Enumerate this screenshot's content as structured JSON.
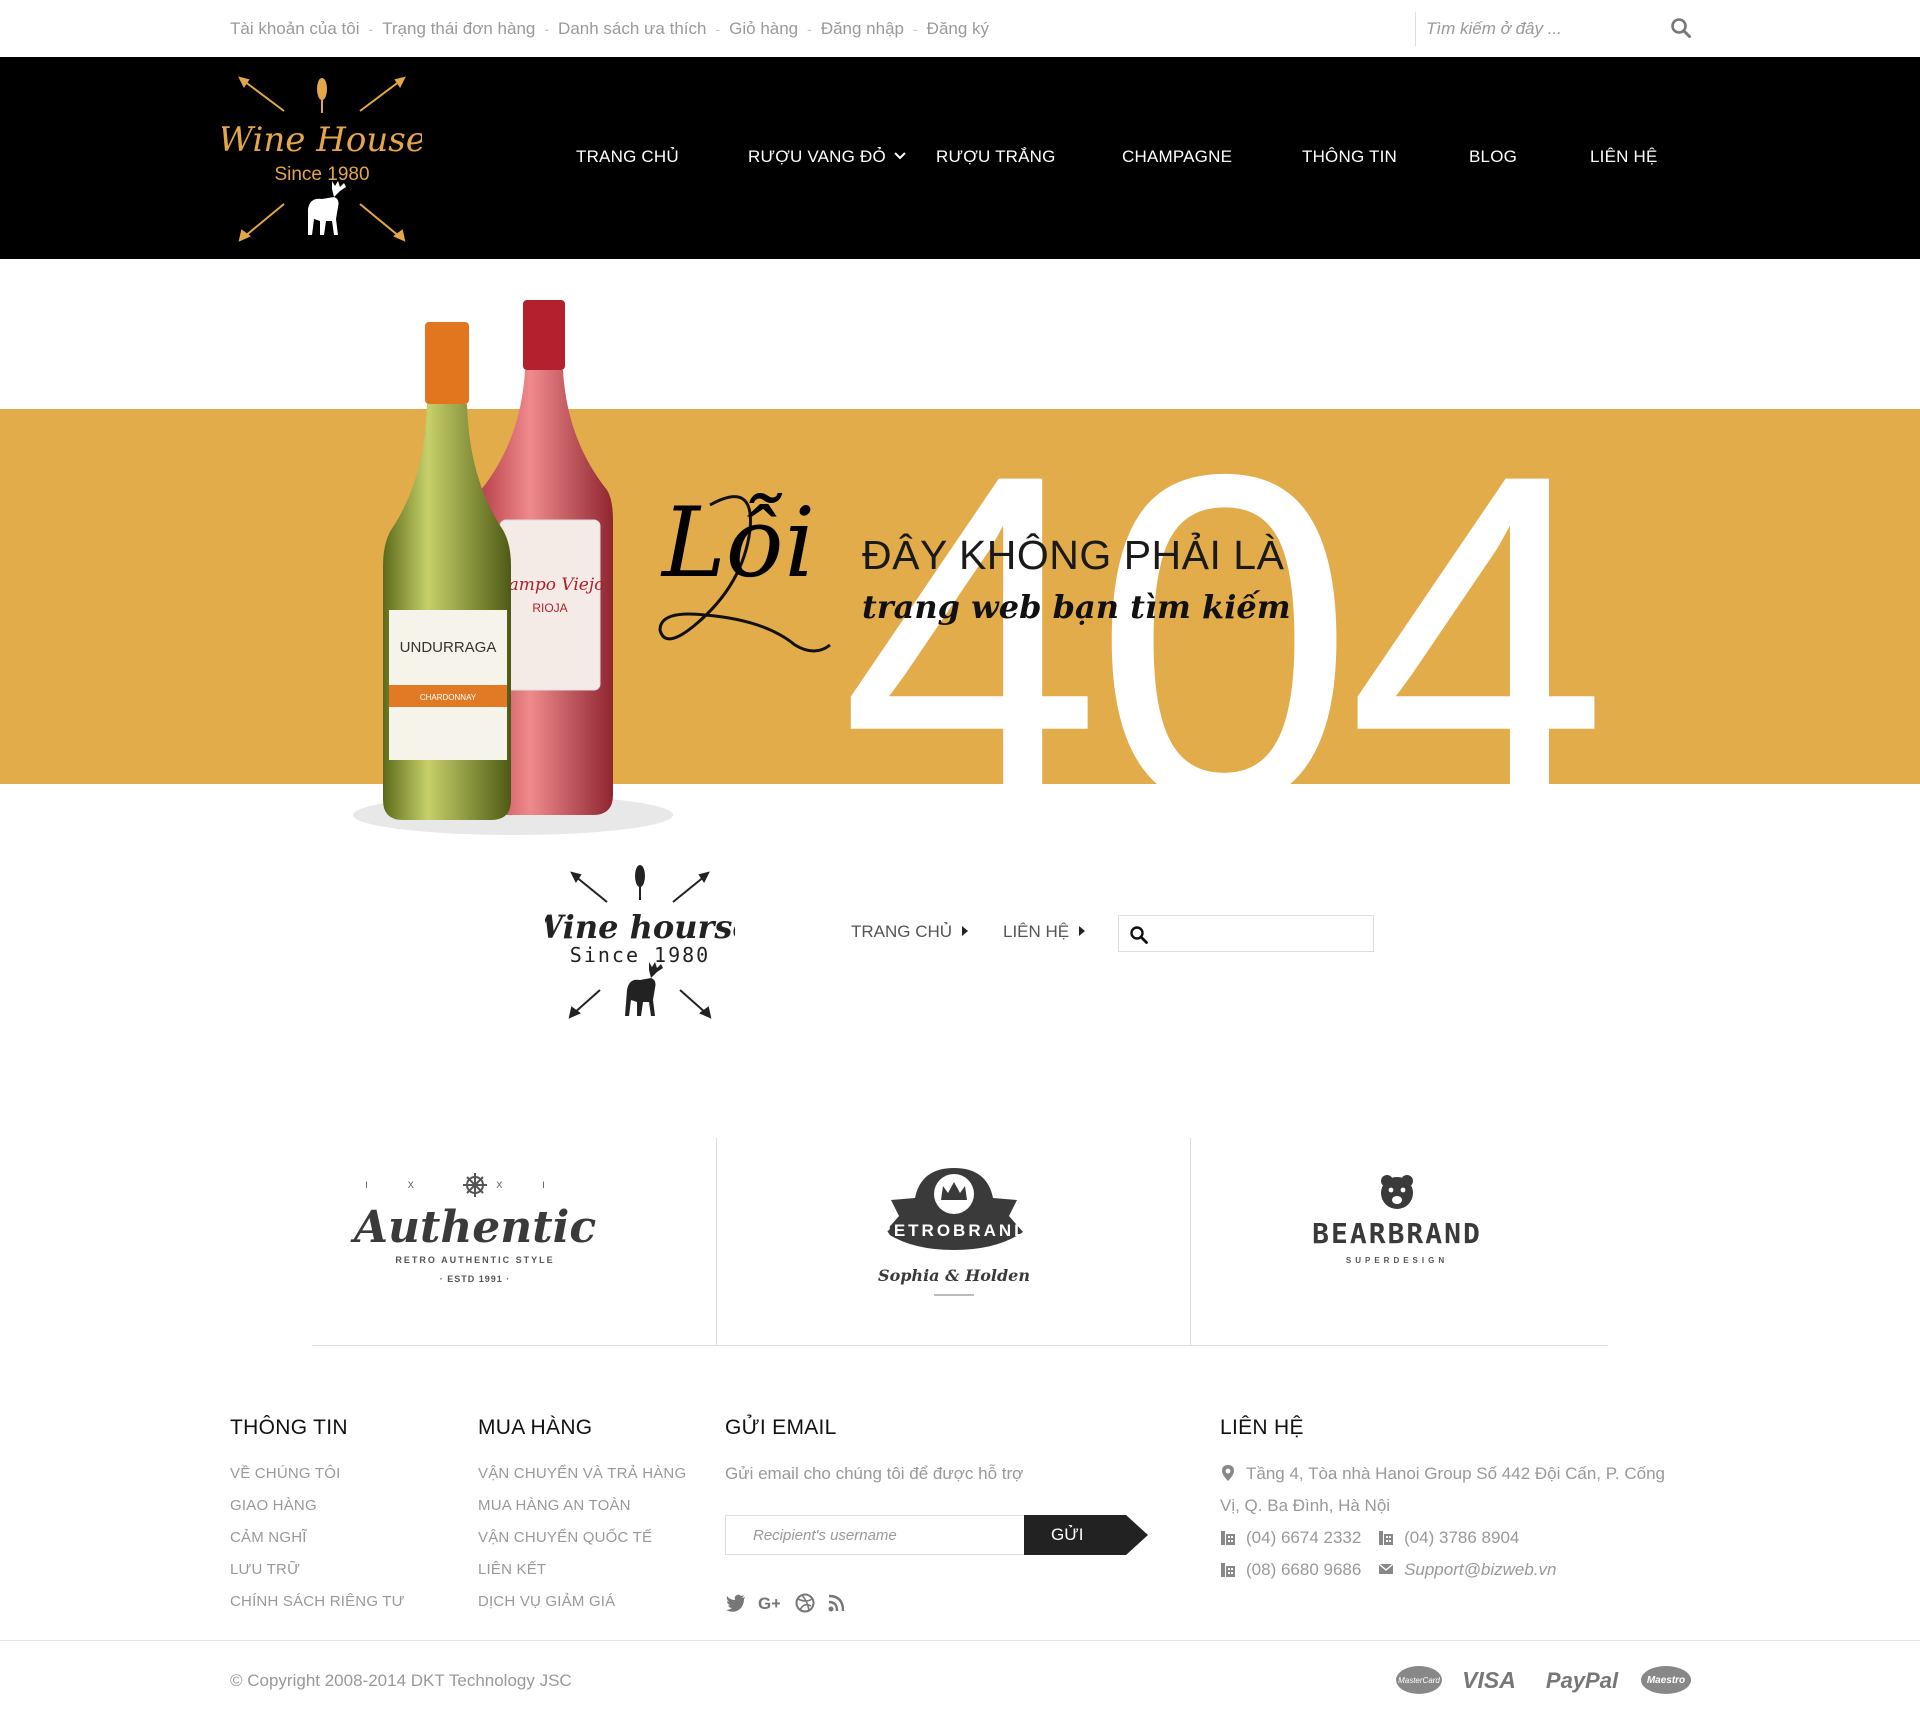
{
  "topbar": {
    "links": [
      "Tài khoản của tôi",
      "Trạng thái đơn hàng",
      "Danh sách ưa thích",
      "Giỏ hàng",
      "Đăng nhập",
      "Đăng ký"
    ],
    "separator": "-",
    "search_placeholder": "Tìm kiếm ở đây ..."
  },
  "header": {
    "logo": {
      "name": "Wine House",
      "tagline": "Since 1980"
    },
    "nav": [
      "TRANG CHỦ",
      "RƯỢU VANG ĐỎ",
      "RƯỢU TRẮNG",
      "CHAMPAGNE",
      "THÔNG TIN",
      "BLOG",
      "LIÊN HỆ"
    ]
  },
  "hero": {
    "code": "404",
    "loi": "Lỗi",
    "headline": "ĐÂY KHÔNG PHẢI LÀ",
    "subline": "trang web bạn tìm kiếm",
    "bottle1_label": "UNDURRAGA",
    "bottle1_sub": "CHARDONNAY",
    "bottle2_label": "Campo Viejo",
    "bottle2_sub": "RIOJA",
    "band_color": "#e3ac4a"
  },
  "secondary": {
    "logo": {
      "name": "Wine hourse",
      "tagline": "Since 1980"
    },
    "links": [
      "TRANG CHỦ",
      "LIÊN HỆ"
    ]
  },
  "brands": [
    {
      "name": "Authentic",
      "top": "IX  XI",
      "sub": "RETRO AUTHENTIC STYLE",
      "est": "· ESTD 1991 ·"
    },
    {
      "name": "RETROBRAND",
      "sub": "Sophia & Holden"
    },
    {
      "name": "BEARBRAND",
      "sub": "SUPERDESIGN"
    }
  ],
  "footer": {
    "info": {
      "title": "THÔNG TIN",
      "links": [
        "VỀ CHÚNG TÔI",
        "GIAO HÀNG",
        "CẢM NGHĨ",
        "LƯU TRỮ",
        "CHÍNH SÁCH RIÊNG TƯ"
      ]
    },
    "shop": {
      "title": "MUA HÀNG",
      "links": [
        "VẬN CHUYỂN VÀ TRẢ HÀNG",
        "MUA HÀNG AN TOÀN",
        "VẬN CHUYỂN QUỐC TẾ",
        "LIÊN KẾT",
        "DỊCH VỤ GIẢM GIÁ"
      ]
    },
    "email": {
      "title": "GỬI EMAIL",
      "note": "Gửi email cho chúng tôi để được hỗ trợ",
      "placeholder": "Recipient's username",
      "button": "GỬI"
    },
    "social": [
      "twitter-icon",
      "google-plus-icon",
      "dribbble-icon",
      "rss-icon"
    ],
    "contact": {
      "title": "LIÊN HỆ",
      "address_1": "Tầng 4, Tòa nhà Hanoi Group Số 442 Đội Cấn, P. Cống",
      "address_2": "Vị, Q. Ba Đình, Hà Nội",
      "phone_1": "(04) 6674 2332",
      "phone_2": "(04) 3786 8904",
      "phone_3": "(08) 6680 9686",
      "email": "Support@bizweb.vn"
    },
    "copyright": "© Copyright 2008-2014 DKT Technology JSC",
    "payments": [
      "MasterCard",
      "VISA",
      "PayPal",
      "Maestro"
    ]
  }
}
